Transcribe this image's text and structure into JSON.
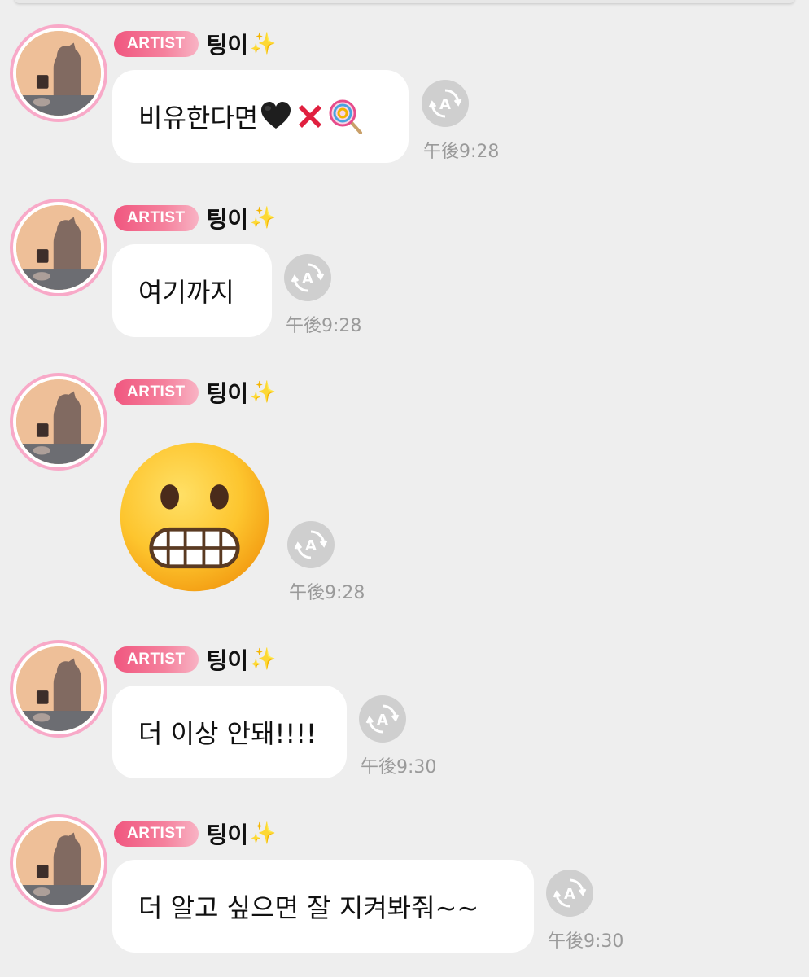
{
  "sender": {
    "badge": "ARTIST",
    "name": "팅이",
    "name_emoji": "✨",
    "avatar": "profile-avatar"
  },
  "messages": [
    {
      "type": "text",
      "text": "비유한다면",
      "emojis": [
        "black-heart",
        "cross-mark",
        "lollipop"
      ],
      "time": "午後9:28"
    },
    {
      "type": "text",
      "text": "여기까지",
      "time": "午後9:28"
    },
    {
      "type": "emoji",
      "emoji": "grimacing-face",
      "time": "午後9:28"
    },
    {
      "type": "text",
      "text": "더 이상 안돼!!!!",
      "time": "午後9:30"
    },
    {
      "type": "text",
      "text": "더 알고 싶으면 잘 지켜봐줘~~",
      "time": "午後9:30"
    }
  ],
  "colors": {
    "background": "#eeeeee",
    "bubble": "#ffffff",
    "badge": "#f0567f",
    "avatar_ring": "#f8a9c8",
    "time": "#9a9a9a",
    "translate_button": "#cfcfcf"
  },
  "icons": {
    "translate": "translate-icon"
  }
}
